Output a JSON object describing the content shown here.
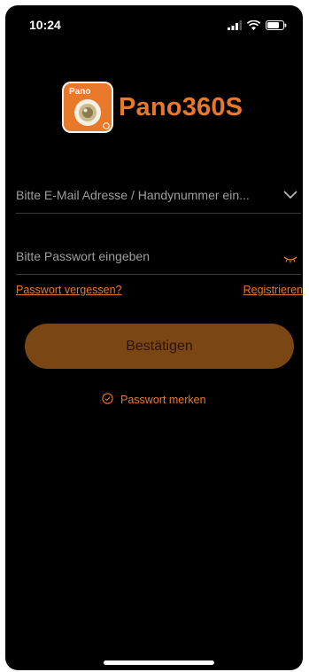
{
  "status_bar": {
    "time": "10:24"
  },
  "brand": {
    "logo_text": "Pano",
    "app_name": "Pano360S",
    "accent_color": "#e9792a"
  },
  "login": {
    "account_placeholder": "Bitte E-Mail Adresse / Handynummer ein...",
    "password_placeholder": "Bitte Passwort eingeben",
    "forgot_password": "Passwort vergessen?",
    "register": "Registrieren",
    "confirm_button": "Bestätigen",
    "remember_password": "Passwort merken"
  },
  "icons": [
    "signal-icon",
    "wifi-icon",
    "battery-icon",
    "chevron-down-icon",
    "eye-closed-icon",
    "check-circle-icon"
  ]
}
